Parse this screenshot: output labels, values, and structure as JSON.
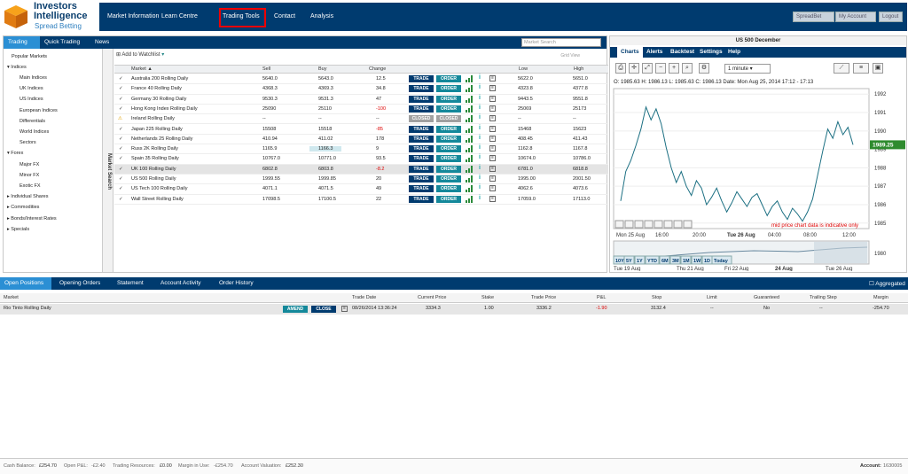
{
  "brand": {
    "line1": "Investors",
    "line2": "Intelligence",
    "line3": "Spread Betting"
  },
  "nav": [
    "Market Information",
    "Learn Centre",
    "Trading Tools",
    "Contact",
    "Analysis"
  ],
  "topright": {
    "spreadbet": "SpreadBet",
    "account": "My Account",
    "logout": "Logout"
  },
  "tabs": [
    "Trading",
    "Quick Trading",
    "News"
  ],
  "search_placeholder": "Market Search",
  "tree": [
    "Popular Markets",
    "Indices",
    "Main Indices",
    "UK Indices",
    "US Indices",
    "European Indices",
    "Differentials",
    "World Indices",
    "Sectors",
    "Forex",
    "Major FX",
    "Minor FX",
    "Exotic FX",
    "Individual Shares",
    "Commodities",
    "Bonds/Interest Rates",
    "Specials"
  ],
  "market_search_label": "Market Search",
  "watchlist": "Add to Watchlist",
  "gridview": "Grid View",
  "columns": {
    "market": "Market",
    "sell": "Sell",
    "buy": "Buy",
    "change": "Change",
    "low": "Low",
    "high": "High"
  },
  "markets": [
    {
      "name": "Australia 200 Rolling Daily",
      "sell": "5640.0",
      "buy": "5643.0",
      "change": "12.5",
      "low": "5622.0",
      "high": "5651.0"
    },
    {
      "name": "France 40 Rolling Daily",
      "sell": "4368.3",
      "buy": "4369.3",
      "change": "34.8",
      "low": "4323.8",
      "high": "4377.8"
    },
    {
      "name": "Germany 30 Rolling Daily",
      "sell": "9530.3",
      "buy": "9531.3",
      "change": "47",
      "low": "9443.5",
      "high": "9551.8"
    },
    {
      "name": "Hong Kong Index Rolling Daily",
      "sell": "25090",
      "buy": "25110",
      "change": "-100",
      "low": "25069",
      "high": "25173"
    },
    {
      "name": "Ireland Rolling Daily",
      "sell": "--",
      "buy": "--",
      "change": "--",
      "low": "--",
      "high": "--"
    },
    {
      "name": "Japan 225 Rolling Daily",
      "sell": "15508",
      "buy": "15518",
      "change": "-85",
      "low": "15468",
      "high": "15623"
    },
    {
      "name": "Netherlands 25 Rolling Daily",
      "sell": "410.94",
      "buy": "411.02",
      "change": "178",
      "low": "408.45",
      "high": "411.43"
    },
    {
      "name": "Russ 2K Rolling Daily",
      "sell": "1165.9",
      "buy": "1166.3",
      "change": "9",
      "low": "1162.8",
      "high": "1167.8"
    },
    {
      "name": "Spain 35 Rolling Daily",
      "sell": "10767.0",
      "buy": "10771.0",
      "change": "93.5",
      "low": "10674.0",
      "high": "10786.0"
    },
    {
      "name": "UK 100 Rolling Daily",
      "sell": "6802.8",
      "buy": "6803.8",
      "change": "-8.2",
      "low": "6781.0",
      "high": "6818.8"
    },
    {
      "name": "US 500 Rolling Daily",
      "sell": "1999.55",
      "buy": "1999.85",
      "change": "20",
      "low": "1995.00",
      "high": "2001.50"
    },
    {
      "name": "US Tech 100 Rolling Daily",
      "sell": "4071.1",
      "buy": "4071.5",
      "change": "49",
      "low": "4062.6",
      "high": "4073.6"
    },
    {
      "name": "Wall Street Rolling Daily",
      "sell": "17098.5",
      "buy": "17100.5",
      "change": "22",
      "low": "17059.0",
      "high": "17113.0"
    }
  ],
  "buttons": {
    "trade": "TRADE",
    "order": "ORDER",
    "closed": "CLOSED"
  },
  "chart_panel": {
    "title": "US 500 December",
    "tabs": [
      "Charts",
      "Alerts",
      "Backtest",
      "Settings",
      "Help"
    ],
    "interval": "1 minute",
    "ohlc": "O: 1985.63   H: 1986.13   L: 1985.63   C: 1986.13   Date: Mon Aug 25, 2014 17:12 - 17:13",
    "notice": "mid price chart data is indicative only",
    "current": "1989.25",
    "nav_buttons": [
      "10Y",
      "5Y",
      "1Y",
      "YTD",
      "6M",
      "3M",
      "1M",
      "1W",
      "1D",
      "Today"
    ]
  },
  "chart_data": {
    "type": "line",
    "title": "",
    "xlabel": "",
    "ylabel": "",
    "x_ticks": [
      "Mon 25 Aug",
      "16:00",
      "20:00",
      "Tue 26 Aug",
      "04:00",
      "08:00",
      "12:00"
    ],
    "y_ticks": [
      1992,
      1991,
      1990,
      1989,
      1988,
      1987,
      1986,
      1985
    ],
    "ylim": [
      1984.7,
      1992.3
    ],
    "series": [
      {
        "values": [
          1986.2,
          1987.8,
          1988.4,
          1989.2,
          1990.1,
          1991.3,
          1990.6,
          1991.2,
          1990.4,
          1989.1,
          1988.0,
          1987.2,
          1987.8,
          1987.0,
          1986.5,
          1987.3,
          1986.9,
          1986.0,
          1986.4,
          1986.9,
          1986.2,
          1985.6,
          1986.1,
          1986.7,
          1986.3,
          1985.9,
          1986.4,
          1986.6,
          1986.0,
          1985.4,
          1985.9,
          1986.2,
          1985.6,
          1985.2,
          1985.8,
          1985.5,
          1985.1,
          1985.6,
          1986.3,
          1987.6,
          1988.9,
          1990.1,
          1989.6,
          1990.5,
          1989.8,
          1990.2,
          1989.25
        ]
      }
    ],
    "nav_ticks": [
      "Tue 19 Aug",
      "Thu 21 Aug",
      "Fri 22 Aug",
      "24 Aug",
      "Tue 26 Aug"
    ],
    "nav_y": "1980"
  },
  "bottom_tabs": [
    "Open Positions",
    "Opening Orders",
    "Statement",
    "Account Activity",
    "Order History"
  ],
  "aggregated": "Aggregated",
  "positions_cols": [
    "Market",
    "Trade Date",
    "Current Price",
    "Stake",
    "Trade Price",
    "P&L",
    "Stop",
    "Limit",
    "Guaranteed",
    "Trailing Step",
    "Margin"
  ],
  "position": {
    "market": "Rio Tinto Rolling Daily",
    "amend": "AMEND",
    "close": "CLOSE",
    "date": "08/26/2014 13:36:24",
    "current": "3334.3",
    "stake": "1.00",
    "trade_price": "3336.2",
    "pnl": "-1.90",
    "stop": "3132.4",
    "limit": "--",
    "guaranteed": "No",
    "trailing": "--",
    "margin": "-254.70"
  },
  "footer": {
    "cash_label": "Cash Balance:",
    "cash": "£254.70",
    "pnl_label": "Open P&L:",
    "pnl": "-£2.40",
    "res_label": "Trading Resources:",
    "res": "£0.00",
    "margin_label": "Margin in Use:",
    "margin": "-£254.70",
    "val_label": "Account Valuation:",
    "val": "£252.30",
    "acct_label": "Account:",
    "acct": "1630005"
  }
}
